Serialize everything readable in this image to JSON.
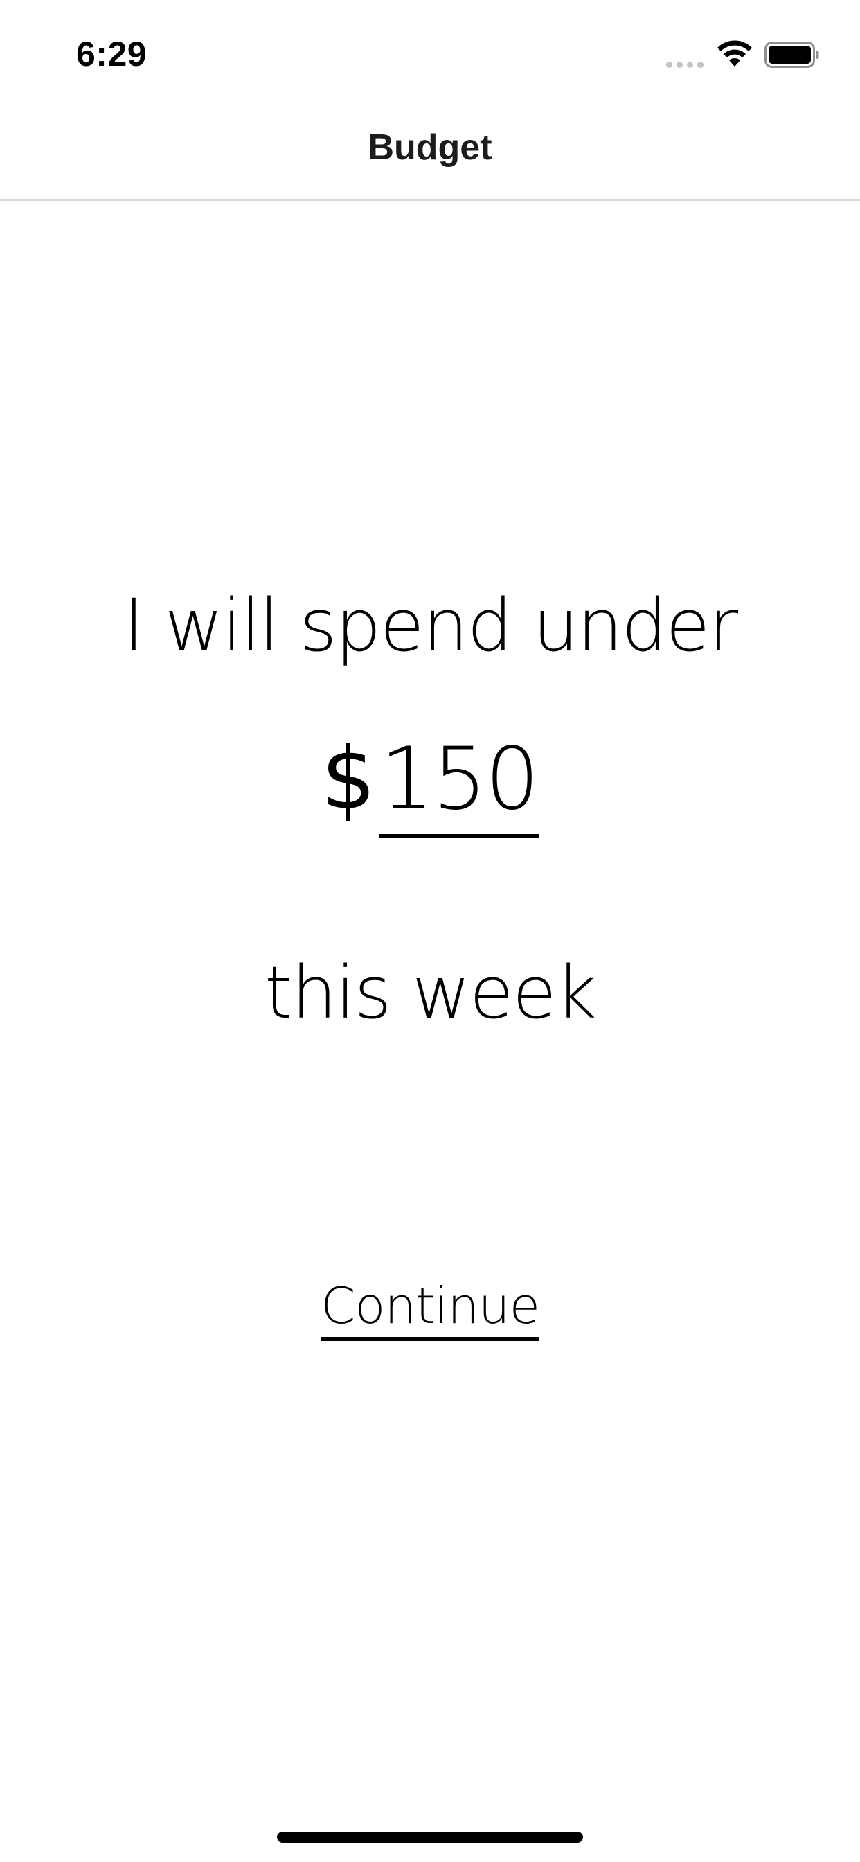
{
  "status_bar": {
    "time": "6:29",
    "signal_icon": "cellular-signal-icon",
    "wifi_icon": "wifi-icon",
    "battery_icon": "battery-icon"
  },
  "nav": {
    "title": "Budget"
  },
  "budget": {
    "line_1": "I will spend under",
    "currency_symbol": "$",
    "amount": "150",
    "line_3": "this week"
  },
  "actions": {
    "continue_label": "Continue"
  }
}
